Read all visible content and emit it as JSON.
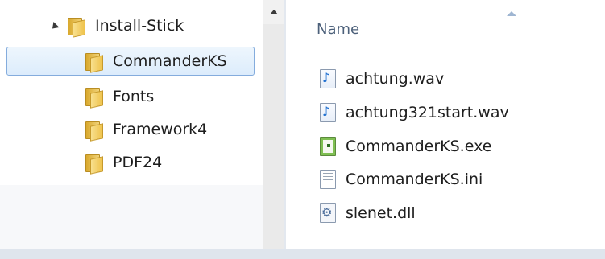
{
  "navigation": {
    "root": {
      "label": "Install-Stick",
      "expanded": true
    },
    "children": [
      {
        "label": "CommanderKS",
        "selected": true
      },
      {
        "label": "Fonts"
      },
      {
        "label": "Framework4"
      },
      {
        "label": "PDF24"
      }
    ]
  },
  "file_list": {
    "column_header": "Name",
    "files": [
      {
        "name": "achtung.wav",
        "icon": "audio-file-icon"
      },
      {
        "name": "achtung321start.wav",
        "icon": "audio-file-icon"
      },
      {
        "name": "CommanderKS.exe",
        "icon": "executable-icon"
      },
      {
        "name": "CommanderKS.ini",
        "icon": "text-file-icon"
      },
      {
        "name": "slenet.dll",
        "icon": "dll-file-icon"
      }
    ]
  },
  "colors": {
    "selection_border": "#84acdd",
    "selection_fill": "#dcecfc",
    "header_text": "#4c607a"
  }
}
